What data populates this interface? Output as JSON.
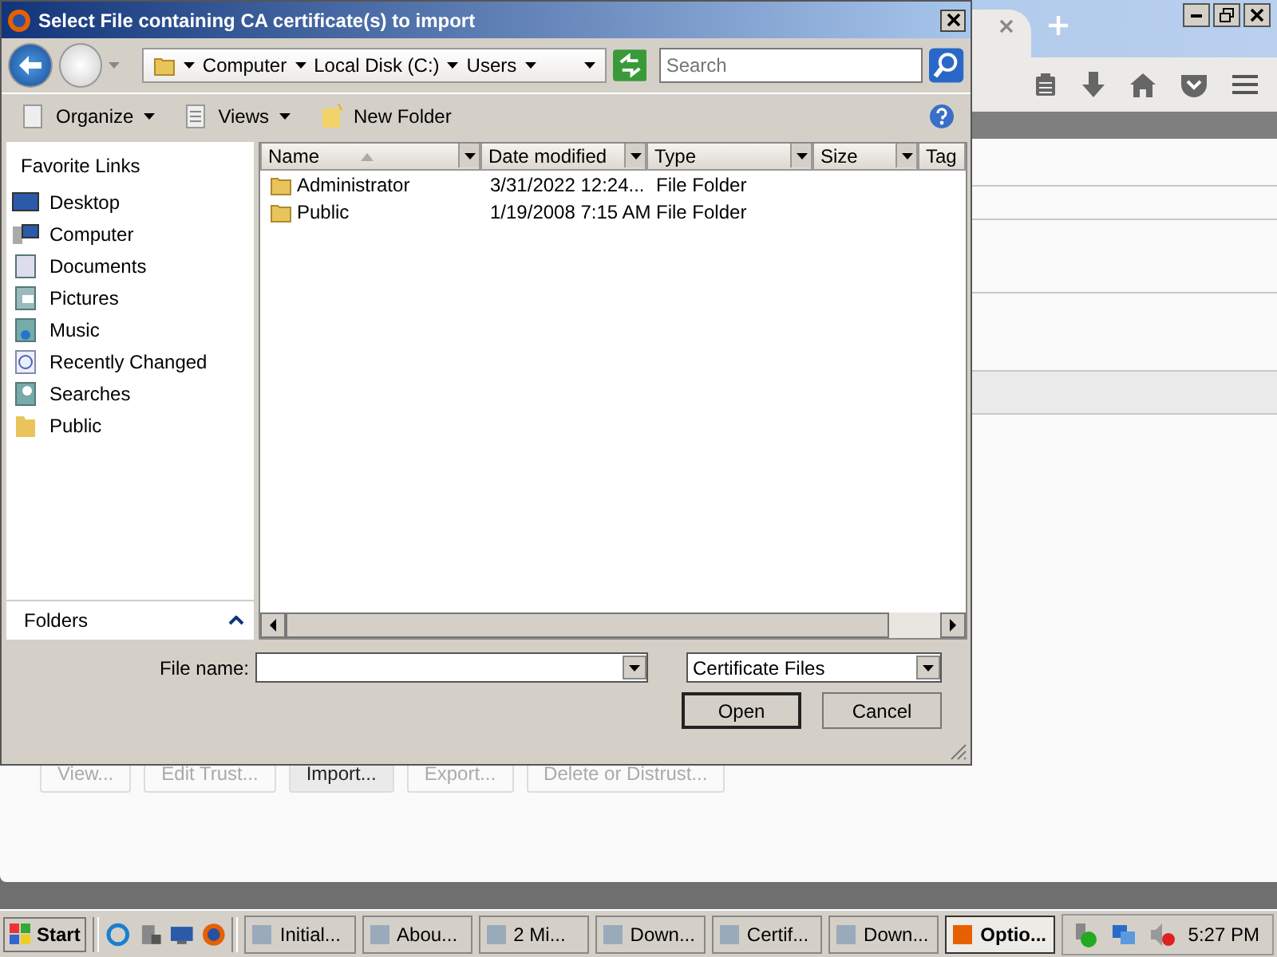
{
  "dialog": {
    "title": "Select File containing CA certificate(s) to import",
    "breadcrumb": [
      "Computer",
      "Local Disk (C:)",
      "Users"
    ],
    "search": {
      "placeholder": "Search"
    },
    "toolbar": [
      "Organize",
      "Views",
      "New Folder"
    ],
    "favorites_title": "Favorite Links",
    "favorites": [
      {
        "label": "Desktop",
        "kind": "desktop"
      },
      {
        "label": "Computer",
        "kind": "computer"
      },
      {
        "label": "Documents",
        "kind": "documents"
      },
      {
        "label": "Pictures",
        "kind": "pictures"
      },
      {
        "label": "Music",
        "kind": "music"
      },
      {
        "label": "Recently Changed",
        "kind": "recent"
      },
      {
        "label": "Searches",
        "kind": "searches"
      },
      {
        "label": "Public",
        "kind": "folder"
      }
    ],
    "folders_label": "Folders",
    "columns": [
      "Name",
      "Date modified",
      "Type",
      "Size",
      "Tag"
    ],
    "rows": [
      {
        "name": "Administrator",
        "date": "3/31/2022 12:24...",
        "type": "File Folder"
      },
      {
        "name": "Public",
        "date": "1/19/2008 7:15 AM",
        "type": "File Folder"
      }
    ],
    "file_name_label": "File name:",
    "file_type": "Certificate Files",
    "buttons": [
      {
        "label": "Open",
        "default": true
      },
      {
        "label": "Cancel",
        "default": false
      }
    ]
  },
  "browser": {
    "buttons": [
      {
        "label": "View...",
        "disabled": true
      },
      {
        "label": "Edit Trust...",
        "disabled": true
      },
      {
        "label": "Import...",
        "disabled": false
      },
      {
        "label": "Export...",
        "disabled": true
      },
      {
        "label": "Delete or Distrust...",
        "disabled": true
      }
    ]
  },
  "taskbar": {
    "start": "Start",
    "tasks": [
      {
        "label": "Initial...",
        "selected": false
      },
      {
        "label": "Abou...",
        "selected": false
      },
      {
        "label": "2 Mi...",
        "selected": false
      },
      {
        "label": "Down...",
        "selected": false
      },
      {
        "label": "Certif...",
        "selected": false
      },
      {
        "label": "Down...",
        "selected": false
      },
      {
        "label": "Optio...",
        "selected": true
      }
    ],
    "clock": "5:27 PM"
  }
}
